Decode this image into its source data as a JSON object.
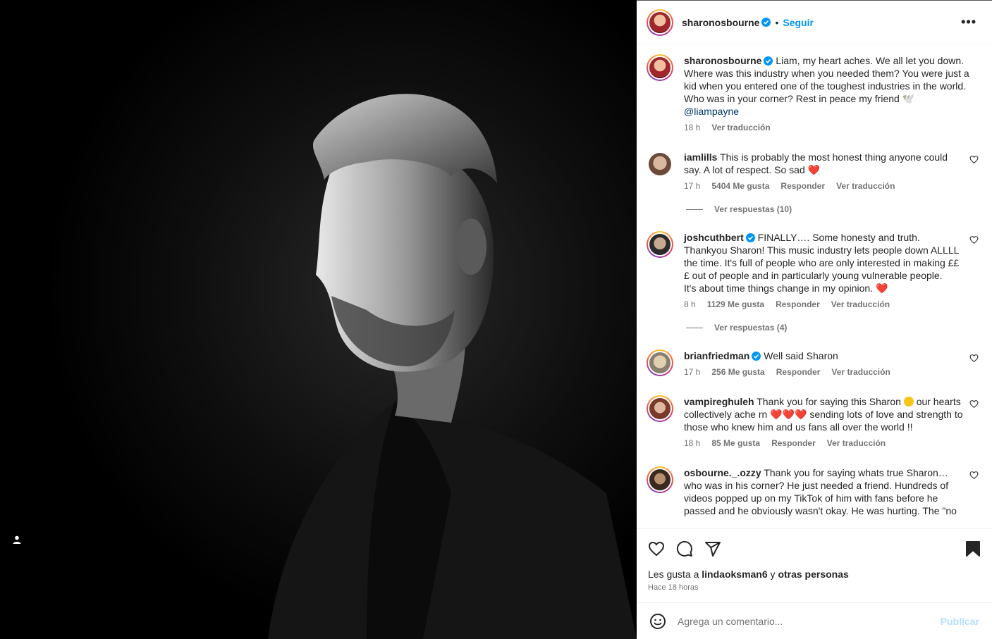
{
  "post": {
    "author": "sharonosbourne",
    "follow_label": "Seguir",
    "more_label": "•••",
    "dot": "•"
  },
  "caption": {
    "author": "sharonosbourne",
    "text": "Liam, my heart aches. We all let you down. Where was this industry when you needed them? You were just a kid when you entered one of the toughest industries in the world. Who was in your corner? Rest in peace my friend 🕊️",
    "mention": "@liampayne",
    "time": "18 h",
    "translate": "Ver traducción"
  },
  "comments": [
    {
      "user": "iamlills",
      "verified": false,
      "text": "This is probably the most honest thing anyone could say. A lot of respect. So sad",
      "emoji": "❤️",
      "time": "17 h",
      "likes": "5404 Me gusta",
      "reply": "Responder",
      "translate": "Ver traducción",
      "replies": "Ver respuestas (10)"
    },
    {
      "user": "joshcuthbert",
      "verified": true,
      "text": "FINALLY…. Some honesty and truth. Thankyou Sharon! This music industry lets people down ALLLL the time. It's full of people who are only interested in making £££ out of people and in particularly young vulnerable people.",
      "text2": "It's about time things change in my opinion.",
      "emoji": "❤️",
      "time": "8 h",
      "likes": "1129 Me gusta",
      "reply": "Responder",
      "translate": "Ver traducción",
      "replies": "Ver respuestas (4)"
    },
    {
      "user": "brianfriedman",
      "verified": true,
      "text": "Well said Sharon",
      "time": "17 h",
      "likes": "256 Me gusta",
      "reply": "Responder",
      "translate": "Ver traducción"
    },
    {
      "user": "vampireghuleh",
      "verified": false,
      "text_a": "Thank you for saying this Sharon",
      "text_b": "our hearts collectively ache rn",
      "hearts": "❤️❤️❤️",
      "text_c": "sending lots of love and strength to those who knew him and us fans all over the world !!",
      "time": "18 h",
      "likes": "85 Me gusta",
      "reply": "Responder",
      "translate": "Ver traducción"
    },
    {
      "user": "osbourne._.ozzy",
      "verified": false,
      "text": "Thank you for saying whats true Sharon… who was in his corner? He just needed a friend. Hundreds of videos popped up on my TikTok of him with fans before he passed and he obviously wasn't okay. He was hurting. The \"no"
    }
  ],
  "footer": {
    "likes_prefix": "Les gusta a",
    "likes_user": "lindaoksman6",
    "likes_mid": "y",
    "likes_suffix": "otras personas",
    "ago": "Hace 18 horas"
  },
  "composer": {
    "placeholder": "Agrega un comentario...",
    "publish": "Publicar"
  },
  "colors": {
    "accent": "#0095f6",
    "heart": "#e0245e"
  }
}
